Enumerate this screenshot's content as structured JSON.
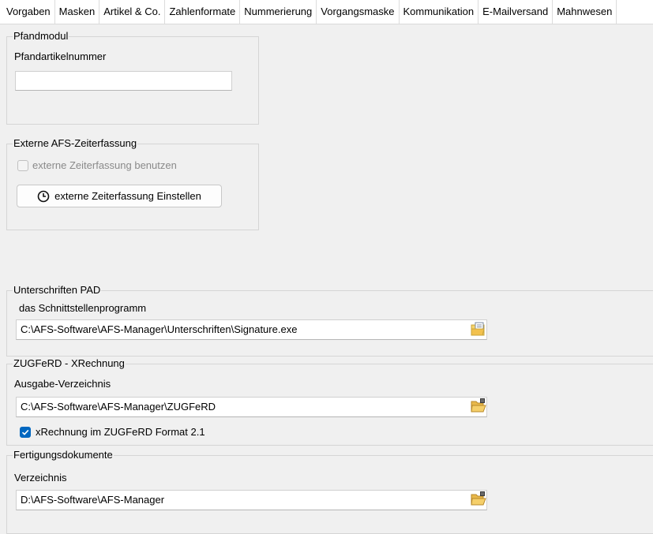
{
  "tabs": [
    "Vorgaben",
    "Masken",
    "Artikel & Co.",
    "Zahlenformate",
    "Nummerierung",
    "Vorgangsmaske",
    "Kommunikation",
    "E-Mailversand",
    "Mahnwesen"
  ],
  "pfand": {
    "legend": "Pfandmodul",
    "field_label": "Pfandartikelnummer",
    "field_value": ""
  },
  "zeiterfassung": {
    "legend": "Externe AFS-Zeiterfassung",
    "checkbox_label": "externe Zeiterfassung benutzen",
    "checkbox_checked": false,
    "button_label": "externe Zeiterfassung Einstellen",
    "button_icon": "clock-icon"
  },
  "unterschriften": {
    "legend": "Unterschriften PAD",
    "field_label": "das Schnittstellenprogramm",
    "field_value": "C:\\AFS-Software\\AFS-Manager\\Unterschriften\\Signature.exe",
    "picker_icon": "file-open-icon"
  },
  "zugferd": {
    "legend": "ZUGFeRD - XRechnung",
    "field_label": "Ausgabe-Verzeichnis",
    "field_value": "C:\\AFS-Software\\AFS-Manager\\ZUGFeRD",
    "picker_icon": "folder-open-icon",
    "checkbox_label": "xRechnung im ZUGFeRD Format 2.1",
    "checkbox_checked": true
  },
  "fertigung": {
    "legend": "Fertigungsdokumente",
    "field_label": "Verzeichnis",
    "field_value": "D:\\AFS-Software\\AFS-Manager",
    "picker_icon": "folder-open-icon"
  },
  "colors": {
    "accent": "#0067c0",
    "background": "#f0f0f0"
  }
}
